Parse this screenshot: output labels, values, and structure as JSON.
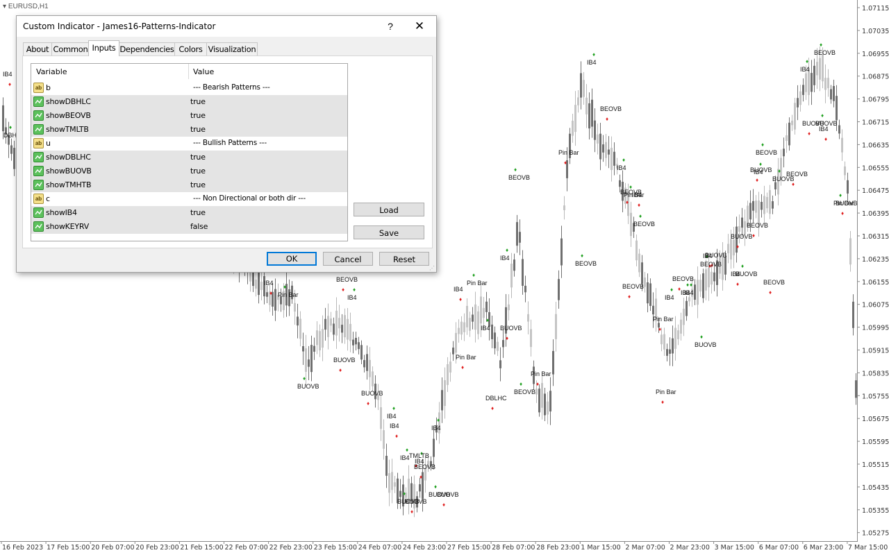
{
  "chart": {
    "symbol": "EURUSD,H1",
    "price_ticks": [
      "1.07115",
      "1.07035",
      "1.06955",
      "1.06875",
      "1.06795",
      "1.06715",
      "1.06635",
      "1.06555",
      "1.06475",
      "1.06395",
      "1.06315",
      "1.06235",
      "1.06155",
      "1.06075",
      "1.05995",
      "1.05915",
      "1.05835",
      "1.05755",
      "1.05675",
      "1.05595",
      "1.05515",
      "1.05435",
      "1.05355",
      "1.05275"
    ],
    "time_ticks": [
      "16 Feb 2023",
      "17 Feb 15:00",
      "20 Feb 07:00",
      "20 Feb 23:00",
      "21 Feb 15:00",
      "22 Feb 07:00",
      "22 Feb 23:00",
      "23 Feb 15:00",
      "24 Feb 07:00",
      "24 Feb 23:00",
      "27 Feb 15:00",
      "28 Feb 07:00",
      "28 Feb 23:00",
      "1 Mar 15:00",
      "2 Mar 07:00",
      "2 Mar 23:00",
      "3 Mar 15:00",
      "6 Mar 07:00",
      "6 Mar 23:00",
      "7 Mar 15:00"
    ],
    "pattern_labels": [
      "IB4",
      "DBH",
      "IB4",
      "Pin Bar",
      "BEOVB",
      "IB4",
      "BUOVB",
      "BUOVB",
      "BUOVB",
      "IB4",
      "IB4",
      "IB4",
      "TMLTB",
      "IB4",
      "BEOVB",
      "BUOVB",
      "BUOVB",
      "BUOVB",
      "BUOVB",
      "IB4",
      "IB4",
      "Pin Bar",
      "Pin Bar",
      "IB4",
      "BUOVB",
      "IB4",
      "DBLHC",
      "BEOVB",
      "Pin Bar",
      "BEOVB",
      "Pin Bar",
      "IB4",
      "BEOVB",
      "IB4",
      "BEOVB",
      "Pin Bar",
      "IB4",
      "BEOVB",
      "BEOVB",
      "BEOVB",
      "Pin Bar",
      "IB4",
      "Pin Bar",
      "BUOVB",
      "BEOVB",
      "IB4",
      "IB4",
      "BEOVB",
      "BUOVB",
      "BUOVB",
      "BEOVB",
      "IB4",
      "BEOVB",
      "BEOVB",
      "BUOVB",
      "BUOVB",
      "BEOVB",
      "IB4",
      "BUOVB",
      "BEOVB",
      "IB4",
      "Pin Bar",
      "BUOVB",
      "IB4",
      "IB4",
      "BUOVB",
      "BUOVB"
    ],
    "colors": {
      "bull": "#c4c4c4",
      "bear": "#6f6f6f",
      "up_arrow": "#e02020",
      "down_arrow": "#1fa01f",
      "axis": "#888888",
      "text": "#333333"
    }
  },
  "dialog": {
    "title": "Custom Indicator - James16-Patterns-Indicator",
    "help_glyph": "?",
    "close_glyph": "✕",
    "tabs": [
      "About",
      "Common",
      "Inputs",
      "Dependencies",
      "Colors",
      "Visualization"
    ],
    "active_tab": "Inputs",
    "columns": {
      "variable": "Variable",
      "value": "Value"
    },
    "inputs": [
      {
        "type": "ab",
        "name": "b",
        "value": "--- Bearish Patterns ---"
      },
      {
        "type": "bool",
        "name": "showDBHLC",
        "value": "true"
      },
      {
        "type": "bool",
        "name": "showBEOVB",
        "value": "true"
      },
      {
        "type": "bool",
        "name": "showTMLTB",
        "value": "true"
      },
      {
        "type": "ab",
        "name": "u",
        "value": "--- Bullish Patterns ---"
      },
      {
        "type": "bool",
        "name": "showDBLHC",
        "value": "true"
      },
      {
        "type": "bool",
        "name": "showBUOVB",
        "value": "true"
      },
      {
        "type": "bool",
        "name": "showTMHTB",
        "value": "true"
      },
      {
        "type": "ab",
        "name": "c",
        "value": "--- Non Directional or both dir ---"
      },
      {
        "type": "bool",
        "name": "showIB4",
        "value": "true"
      },
      {
        "type": "bool",
        "name": "showKEYRV",
        "value": "false"
      }
    ],
    "ab_glyph": "ab",
    "load_label": "Load",
    "save_label": "Save",
    "ok_label": "OK",
    "cancel_label": "Cancel",
    "reset_label": "Reset"
  }
}
